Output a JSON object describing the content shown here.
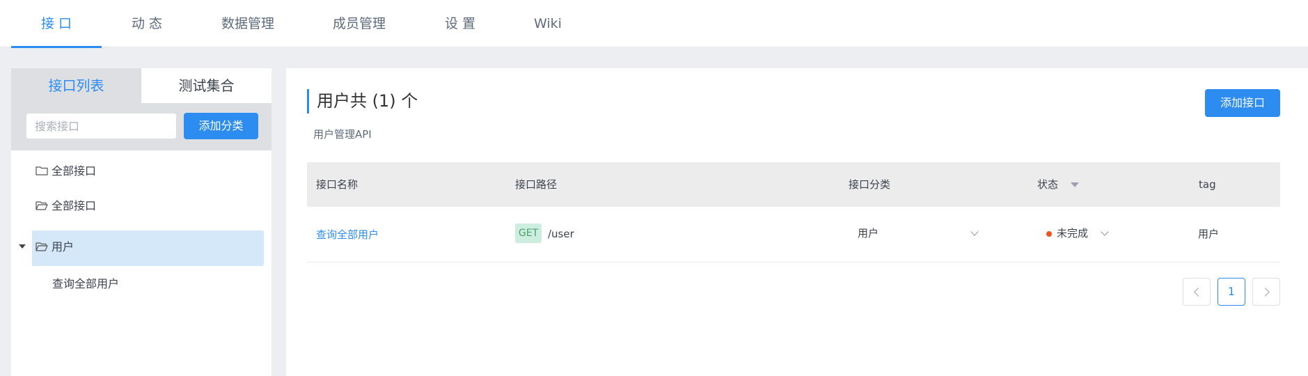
{
  "top_nav": {
    "tabs": [
      {
        "label": "接 口"
      },
      {
        "label": "动 态"
      },
      {
        "label": "数据管理"
      },
      {
        "label": "成员管理"
      },
      {
        "label": "设 置"
      },
      {
        "label": "Wiki"
      }
    ],
    "active": "接 口"
  },
  "sidebar": {
    "tabs": [
      {
        "label": "接口列表"
      },
      {
        "label": "测试集合"
      }
    ],
    "search": {
      "placeholder": "搜索接口",
      "value": ""
    },
    "add_category_label": "添加分类",
    "tree": [
      {
        "label": "全部接口",
        "icon": "folder-icon"
      },
      {
        "label": "全部接口",
        "icon": "folder-open-icon"
      },
      {
        "label": "用户",
        "icon": "folder-open-icon",
        "selected": true,
        "expanded": true
      },
      {
        "label": "查询全部用户"
      }
    ]
  },
  "main": {
    "title": "用户共 (1) 个",
    "subtitle": "用户管理API",
    "add_api_label": "添加接口",
    "table": {
      "headers": [
        "接口名称",
        "接口路径",
        "接口分类",
        "状态",
        "tag"
      ],
      "rows": [
        {
          "name": "查询全部用户",
          "method": "GET",
          "path": "/user",
          "category": "用户",
          "status": "未完成",
          "tag": "用户"
        }
      ]
    },
    "pagination": {
      "current": "1"
    }
  },
  "colors": {
    "accent": "#2d8cf0",
    "status_dot": "#f4511e",
    "get_badge_bg": "#cdeede",
    "selected_bg": "#d5e8f9"
  }
}
